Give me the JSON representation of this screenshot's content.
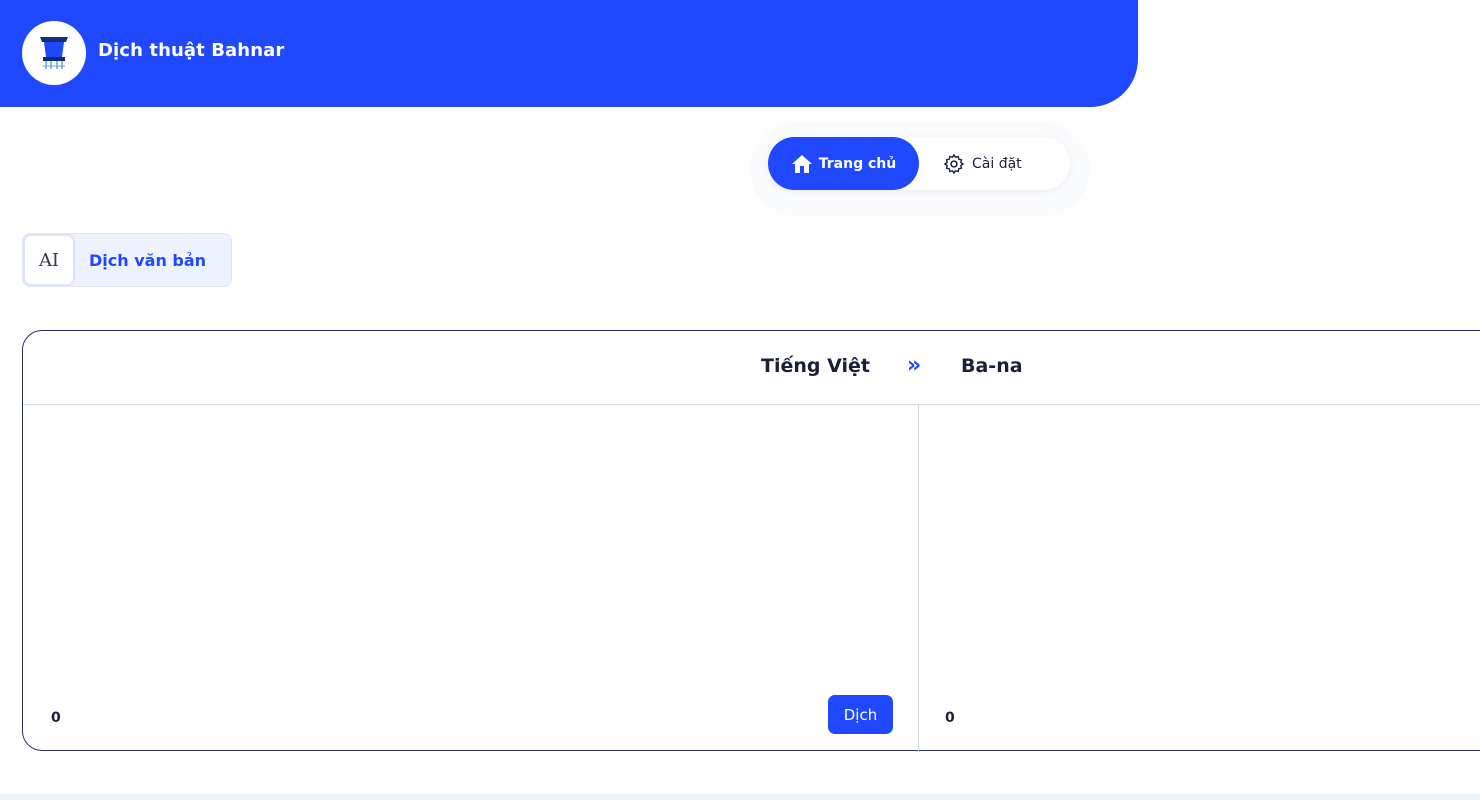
{
  "app": {
    "title": "Dịch thuật Bahnar",
    "brand_color": "#1f48ff"
  },
  "nav": {
    "home_label": "Trang chủ",
    "home_icon": "home-icon",
    "settings_label": "Cài đặt",
    "settings_icon": "gear-icon"
  },
  "mode": {
    "icon_text": "AI",
    "icon": "text-translate-icon",
    "label": "Dịch văn bản"
  },
  "translator": {
    "source_language": "Tiếng Việt",
    "swap_icon": "double-chevron-right-icon",
    "swap_glyph": "»",
    "target_language": "Ba-na",
    "source_text": "",
    "source_count": "0",
    "target_count": "0",
    "translate_label": "Dịch"
  }
}
